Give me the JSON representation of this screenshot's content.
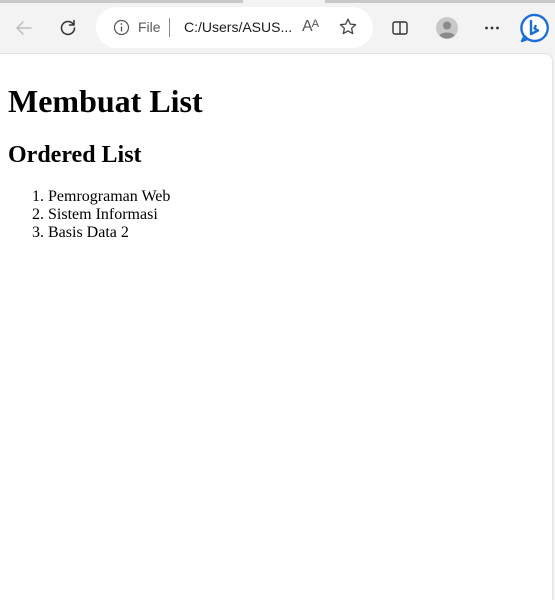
{
  "browser": {
    "address_bar": {
      "scheme_label": "File",
      "url": "C:/Users/ASUS..."
    },
    "read_aloud_glyph": "Aᴬ",
    "accent_color": "#1b6fd6"
  },
  "page": {
    "heading": "Membuat List",
    "subheading": "Ordered List",
    "ordered_list": {
      "items": [
        "Pemrograman Web",
        "Sistem Informasi",
        "Basis Data 2"
      ]
    }
  }
}
